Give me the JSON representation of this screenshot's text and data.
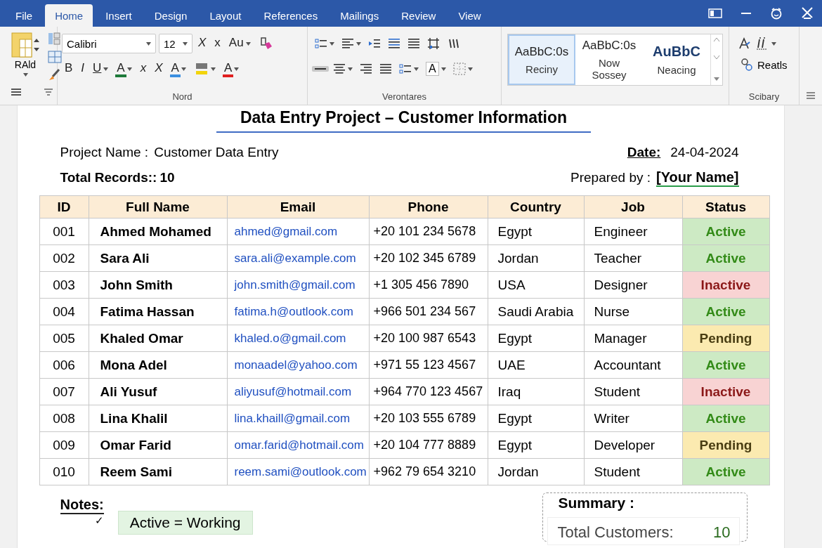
{
  "tabs": [
    {
      "label": "File",
      "selected": false
    },
    {
      "label": "Home",
      "selected": true
    },
    {
      "label": "Insert",
      "selected": false
    },
    {
      "label": "Design",
      "selected": false
    },
    {
      "label": "Layout",
      "selected": false
    },
    {
      "label": "References",
      "selected": false
    },
    {
      "label": "Mailings",
      "selected": false
    },
    {
      "label": "Review",
      "selected": false
    },
    {
      "label": "View",
      "selected": false
    }
  ],
  "ribbon": {
    "clipboard": {
      "label": "RAld"
    },
    "font": {
      "font_name": "Calibri",
      "font_size": "12",
      "group_label": "Nord",
      "row1": [
        {
          "kind": "italic",
          "text": "X",
          "dropdown": false
        },
        {
          "kind": "letter",
          "text": "x",
          "dropdown": false
        },
        {
          "kind": "letter",
          "text": "Au",
          "dropdown": true
        },
        {
          "kind": "eraser",
          "dropdown": false
        }
      ],
      "row2": [
        {
          "kind": "letter",
          "text": "B",
          "dropdown": false
        },
        {
          "kind": "italic",
          "text": "I",
          "dropdown": false
        },
        {
          "kind": "underlined",
          "text": "U",
          "dropdown": true
        },
        {
          "kind": "letter",
          "text": "A",
          "dropdown": true,
          "color": "#1e7a3a"
        },
        {
          "kind": "italic",
          "text": "x",
          "dropdown": false
        },
        {
          "kind": "italic",
          "text": "X",
          "dropdown": false
        },
        {
          "kind": "letter",
          "text": "A",
          "dropdown": true,
          "color": "#3b8fe0"
        },
        {
          "kind": "highlight",
          "dropdown": true,
          "color": "#f2d40c"
        },
        {
          "kind": "letter",
          "text": "A",
          "dropdown": true,
          "color": "#e02020"
        }
      ]
    },
    "paragraph": {
      "group_label": "Verontares",
      "row1": [
        {
          "kind": "bullets",
          "dropdown": true,
          "selected": false
        },
        {
          "kind": "lines-left",
          "dropdown": true,
          "selected": false
        },
        {
          "kind": "indent",
          "dropdown": false,
          "selected": false
        },
        {
          "kind": "lines-blue",
          "dropdown": false,
          "selected": false
        },
        {
          "kind": "lines-justify",
          "dropdown": false,
          "selected": false
        },
        {
          "kind": "frame",
          "dropdown": false,
          "selected": false
        },
        {
          "kind": "marks",
          "dropdown": false,
          "selected": false
        }
      ],
      "row2": [
        {
          "kind": "dash",
          "dropdown": false,
          "selected": true
        },
        {
          "kind": "lines-center",
          "dropdown": true,
          "selected": false
        },
        {
          "kind": "lines-right",
          "dropdown": false,
          "selected": false
        },
        {
          "kind": "lines-justify",
          "dropdown": false,
          "selected": false
        },
        {
          "kind": "bullets",
          "dropdown": true,
          "selected": false
        },
        {
          "kind": "letter-box",
          "text": "A",
          "dropdown": true,
          "selected": false
        },
        {
          "kind": "borders",
          "dropdown": true,
          "selected": false
        }
      ]
    },
    "styles": [
      {
        "sample": "AaBbC:0s",
        "name": "Reciny",
        "selected": true,
        "kind": "normal"
      },
      {
        "sample": "AaBbC:0s",
        "name": "Now Sossey",
        "selected": false,
        "kind": "normal"
      },
      {
        "sample": "AuBbC",
        "name": "Neacing",
        "selected": false,
        "kind": "heading"
      }
    ],
    "editing": {
      "label": "Reatls",
      "group_label": "Scibary"
    }
  },
  "document": {
    "title": "Data Entry Project – Customer Information",
    "project_label": "Project Name :",
    "project_value": "Customer Data Entry",
    "date_label": "Date:",
    "date_value": "24-04-2024",
    "records_label": "Total Records::",
    "records_value": "10",
    "prepared_label": "Prepared by :",
    "prepared_value": "[Your Name]"
  },
  "table": {
    "columns": [
      "ID",
      "Full Name",
      "Email",
      "Phone",
      "Country",
      "Job",
      "Status"
    ],
    "rows": [
      {
        "id": "001",
        "name": "Ahmed Mohamed",
        "email": "ahmed@gmail.com",
        "phone": "+20 101 234 5678",
        "country": "Egypt",
        "job": "Engineer",
        "status": "Active",
        "color": "#cdeac4"
      },
      {
        "id": "002",
        "name": "Sara Ali",
        "email": "sara.ali@example.com",
        "phone": "+20 102 345 6789",
        "country": "Jordan",
        "job": "Teacher",
        "status": "Active",
        "color": "#cdeac4"
      },
      {
        "id": "003",
        "name": "John Smith",
        "email": "john.smith@gmail.com",
        "phone": "+1 305 456 7890",
        "country": "USA",
        "job": "Designer",
        "status": "Inactive",
        "color": "#f8d3d3"
      },
      {
        "id": "004",
        "name": "Fatima Hassan",
        "email": "fatima.h@outlook.com",
        "phone": "+966 501 234 567",
        "country": "Saudi Arabia",
        "job": "Nurse",
        "status": "Active",
        "color": "#cdeac4"
      },
      {
        "id": "005",
        "name": "Khaled Omar",
        "email": "khaled.o@gmail.com",
        "phone": "+20 100 987 6543",
        "country": "Egypt",
        "job": "Manager",
        "status": "Pending",
        "color": "#fbeab0"
      },
      {
        "id": "006",
        "name": "Mona Adel",
        "email": "monaadel@yahoo.com",
        "phone": "+971 55 123 4567",
        "country": "UAE",
        "job": "Accountant",
        "status": "Active",
        "color": "#cdeac4"
      },
      {
        "id": "007",
        "name": "Ali Yusuf",
        "email": "aliyusuf@hotmail.com",
        "phone": "+964 770 123 4567",
        "country": "Iraq",
        "job": "Student",
        "status": "Inactive",
        "color": "#f8d3d3"
      },
      {
        "id": "008",
        "name": "Lina Khalil",
        "email": "lina.khaill@gmail.com",
        "phone": "+20 103 555 6789",
        "country": "Egypt",
        "job": "Writer",
        "status": "Active",
        "color": "#cdeac4"
      },
      {
        "id": "009",
        "name": "Omar Farid",
        "email": "omar.farid@hotmail.com",
        "phone": "+20 104 777 8889",
        "country": "Egypt",
        "job": "Developer",
        "status": "Pending",
        "color": "#fbeab0"
      },
      {
        "id": "010",
        "name": "Reem Sami",
        "email": "reem.sami@outlook.com",
        "phone": "+962 79 654 3210",
        "country": "Jordan",
        "job": "Student",
        "status": "Active",
        "color": "#cdeac4"
      }
    ]
  },
  "notes": {
    "label": "Notes:",
    "mark": "✓",
    "items": [
      "Active = Working"
    ]
  },
  "summary": {
    "title": "Summary :",
    "rows": [
      {
        "label": "Total Customers:",
        "value": "10"
      }
    ]
  }
}
